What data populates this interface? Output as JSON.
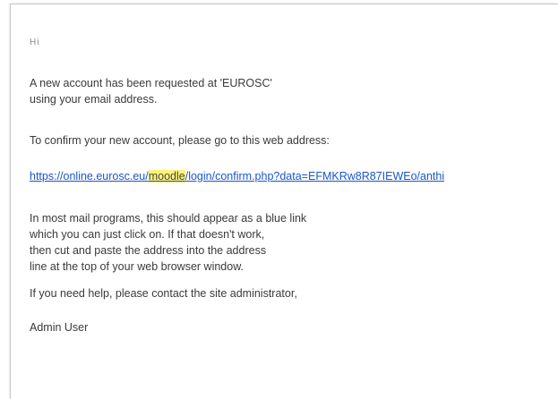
{
  "email": {
    "greeting": "Hi",
    "paragraph1": {
      "line1": "A new account has been requested at 'EUROSC'",
      "line2": "using your email address."
    },
    "paragraph2": "To confirm your new account, please go to this web address:",
    "link": {
      "prefix": "https://online.eurosc.eu/",
      "highlight": "moodle",
      "suffix": "/login/confirm.php?data=EFMKRw8R87IEWEo/anthi"
    },
    "paragraph3": {
      "line1": "In most mail programs, this should appear as a blue link",
      "line2": "which you can just click on. If that doesn't work,",
      "line3": "then cut and paste the address into the address",
      "line4": "line at the top of your web browser window."
    },
    "paragraph4": "If you need help, please contact the site administrator,",
    "signature": "Admin User"
  },
  "colors": {
    "link": "#1a56c9",
    "highlight": "#fff27a",
    "text": "#3a3a3a"
  }
}
